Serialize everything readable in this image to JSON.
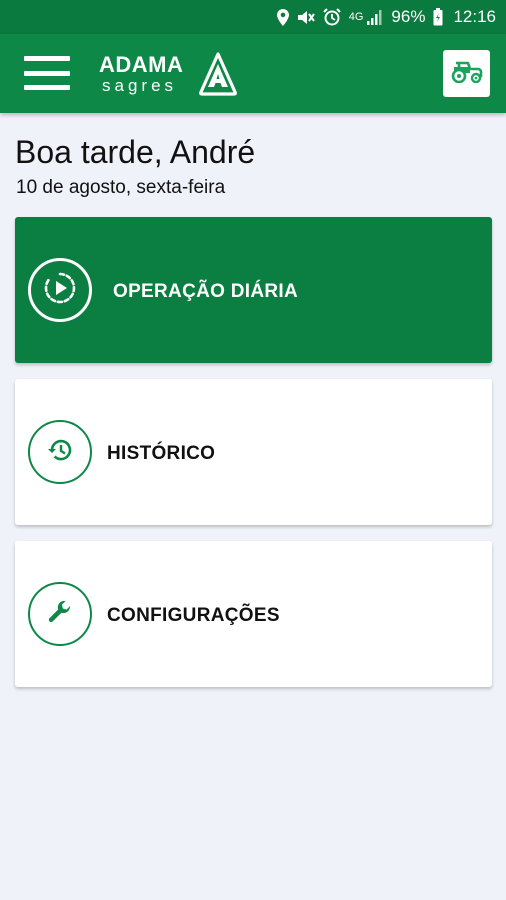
{
  "status_bar": {
    "network": "4G",
    "battery": "96%",
    "time": "12:16",
    "icons": [
      "location-icon",
      "mute-icon",
      "alarm-icon",
      "signal-icon",
      "battery-icon"
    ]
  },
  "app_bar": {
    "brand_name": "ADAMA",
    "brand_sub": "sagres",
    "menu_icon": "hamburger-icon",
    "action_icon": "tractor-icon",
    "colors": {
      "bar": "#0d8847",
      "status": "#0b7a3e"
    }
  },
  "greeting": {
    "title": "Boa tarde, André",
    "date": "10 de agosto, sexta-feira"
  },
  "cards": [
    {
      "label": "OPERAÇÃO DIÁRIA",
      "icon": "play-circle-icon",
      "style": "primary"
    },
    {
      "label": "HISTÓRICO",
      "icon": "history-icon",
      "style": "light"
    },
    {
      "label": "CONFIGURAÇÕES",
      "icon": "wrench-icon",
      "style": "light"
    }
  ],
  "colors": {
    "accent": "#0b7f42",
    "background": "#f0f2fa"
  }
}
